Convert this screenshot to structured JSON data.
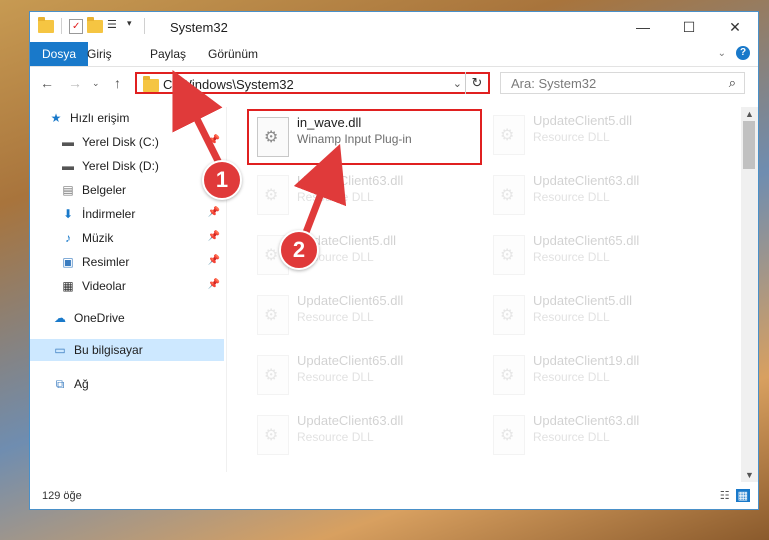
{
  "window": {
    "title": "System32",
    "controls": {
      "minimize": "—",
      "maximize": "☐",
      "close": "✕"
    }
  },
  "ribbon": {
    "tabs": [
      "Dosya",
      "Giriş",
      "Paylaş",
      "Görünüm"
    ],
    "expand_icon": "chevron-down-icon",
    "help_icon": "help-icon"
  },
  "address": {
    "path": "C:\\Windows\\System32",
    "search_placeholder": "Ara: System32"
  },
  "sidebar": {
    "items": [
      {
        "label": "Hızlı erişim",
        "icon": "star-icon",
        "pinned": false
      },
      {
        "label": "Yerel Disk (C:)",
        "icon": "drive-icon",
        "pinned": true
      },
      {
        "label": "Yerel Disk (D:)",
        "icon": "drive-icon",
        "pinned": false
      },
      {
        "label": "Belgeler",
        "icon": "documents-icon",
        "pinned": false
      },
      {
        "label": "İndirmeler",
        "icon": "download-icon",
        "pinned": true
      },
      {
        "label": "Müzik",
        "icon": "music-icon",
        "pinned": true
      },
      {
        "label": "Resimler",
        "icon": "pictures-icon",
        "pinned": true
      },
      {
        "label": "Videolar",
        "icon": "video-icon",
        "pinned": true
      },
      {
        "label": "OneDrive",
        "icon": "cloud-icon",
        "pinned": false
      },
      {
        "label": "Bu bilgisayar",
        "icon": "computer-icon",
        "pinned": false
      },
      {
        "label": "Ağ",
        "icon": "network-icon",
        "pinned": false
      }
    ]
  },
  "files": [
    {
      "name": "in_wave.dll",
      "desc": "Winamp Input Plug-in"
    },
    {
      "name": "UpdateClient5.dll",
      "desc": "Resource DLL"
    },
    {
      "name": "UpdateClient63.dll",
      "desc": "Resource DLL"
    },
    {
      "name": "UpdateClient63.dll",
      "desc": "Resource DLL"
    },
    {
      "name": "UpdateClient5.dll",
      "desc": "Resource DLL"
    },
    {
      "name": "UpdateClient65.dll",
      "desc": "Resource DLL"
    },
    {
      "name": "UpdateClient65.dll",
      "desc": "Resource DLL"
    },
    {
      "name": "UpdateClient5.dll",
      "desc": "Resource DLL"
    },
    {
      "name": "UpdateClient65.dll",
      "desc": "Resource DLL"
    },
    {
      "name": "UpdateClient19.dll",
      "desc": "Resource DLL"
    },
    {
      "name": "UpdateClient63.dll",
      "desc": "Resource DLL"
    },
    {
      "name": "UpdateClient63.dll",
      "desc": "Resource DLL"
    }
  ],
  "status": {
    "count": "129 öğe"
  },
  "annotations": {
    "badge1": "1",
    "badge2": "2",
    "highlight_color": "#e02020",
    "arrow_color": "#e03a3a"
  }
}
